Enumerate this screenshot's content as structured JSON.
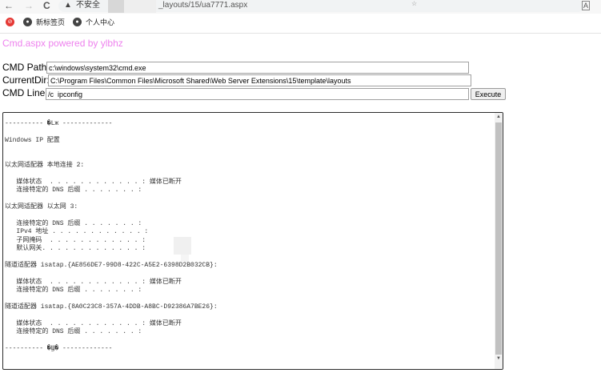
{
  "browser": {
    "back_icon": "←",
    "forward_icon": "→",
    "reload_icon": "C",
    "warning_icon": "▲",
    "security_label": "不安全",
    "url": "_layouts/15/ua7771.aspx",
    "star_icon": "☆",
    "translate_icon": "A"
  },
  "bookmarks": {
    "items": [
      {
        "label": "新标签页"
      },
      {
        "label": "个人中心"
      }
    ]
  },
  "page": {
    "brand": "Cmd.aspx powered by ylbhz",
    "cmd_path_label": "CMD Path:",
    "cmd_path_value": "c:\\windows\\system32\\cmd.exe",
    "current_dir_label": "CurrentDir:",
    "current_dir_value": "C:\\Program Files\\Common Files\\Microsoft Shared\\Web Server Extensions\\15\\template\\layouts",
    "cmd_line_label": "CMD Line:",
    "cmd_line_value": "/c  ipconfig",
    "execute_label": "Execute"
  },
  "output": {
    "text": "---------- �Lж -------------\n\nWindows IP 配置\n\n\n以太网适配器 本地连接 2:\n\n   媒体状态  . . . . . . . . . . . . : 媒体已断开\n   连接特定的 DNS 后缀 . . . . . . . :\n\n以太网适配器 以太网 3:\n\n   连接特定的 DNS 后缀 . . . . . . . :\n   IPv4 地址 . . . . . . . . . . . . :\n   子网掩码  . . . . . . . . . . . . :          0\n   默认网关. . . . . . . . . . . . . :       .1\n\n隧道适配器 isatap.{AE856DE7-99D8-422C-A5E2-6398D2B032CB}:\n\n   媒体状态  . . . . . . . . . . . . : 媒体已断开\n   连接特定的 DNS 后缀 . . . . . . . :\n\n隧道适配器 isatap.{8A0C23C8-357A-4DDB-A8BC-D92386A7BE26}:\n\n   媒体状态  . . . . . . . . . . . . : 媒体已断开\n   连接特定的 DNS 后缀 . . . . . . . :\n\n---------- �Ϣ� -------------"
  }
}
